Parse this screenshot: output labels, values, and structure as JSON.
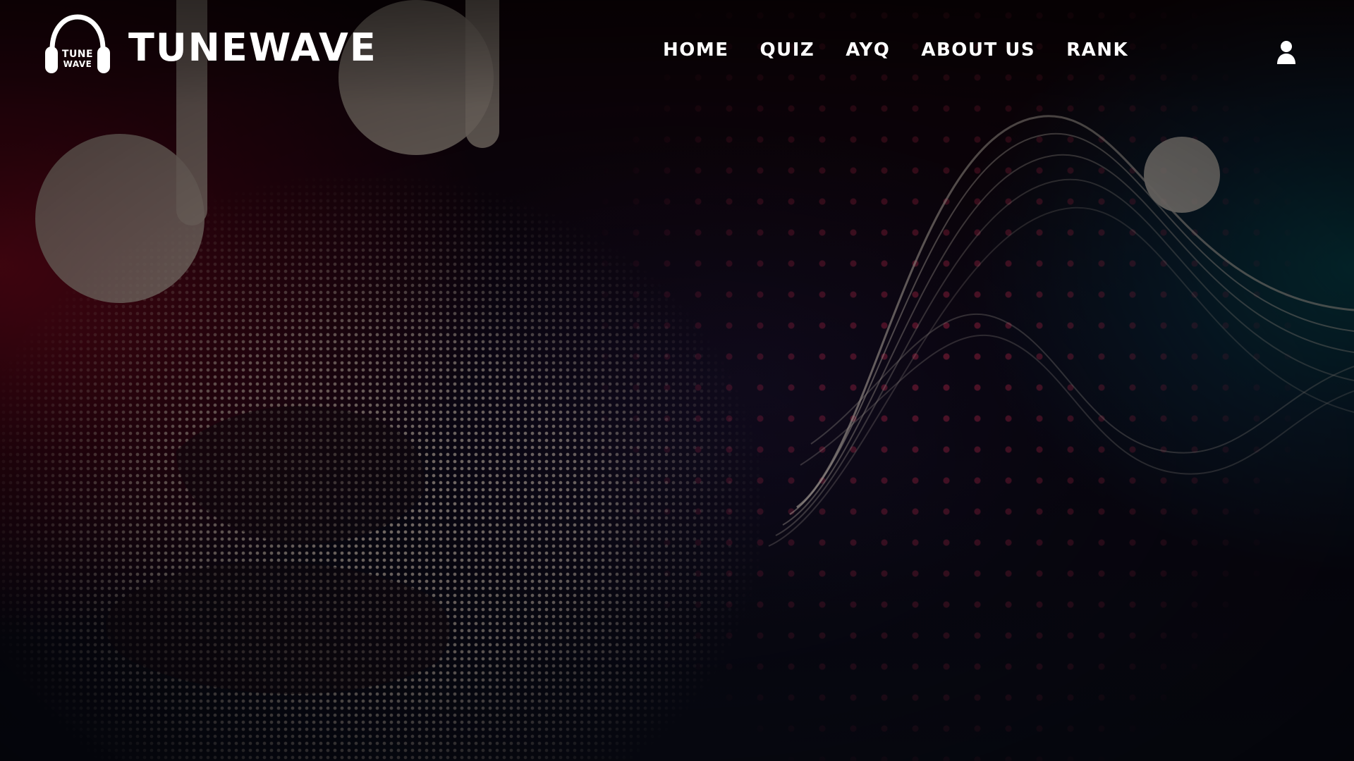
{
  "app": {
    "brand_name": "TUNEWAVE",
    "logo": {
      "line1": "TUNE",
      "line2": "WAVE",
      "icon": "headphones-logo-icon"
    }
  },
  "header": {
    "nav": [
      {
        "label": "HOME"
      },
      {
        "label": "QUIZ"
      },
      {
        "label": "AYQ"
      },
      {
        "label": "ABOUT US"
      },
      {
        "label": "RANK"
      }
    ],
    "user_icon": "user-icon"
  },
  "colors": {
    "text": "#ffffff",
    "accent_red": "#d22a5b",
    "beige": "#d7c8b9",
    "teal": "#0a4654"
  }
}
